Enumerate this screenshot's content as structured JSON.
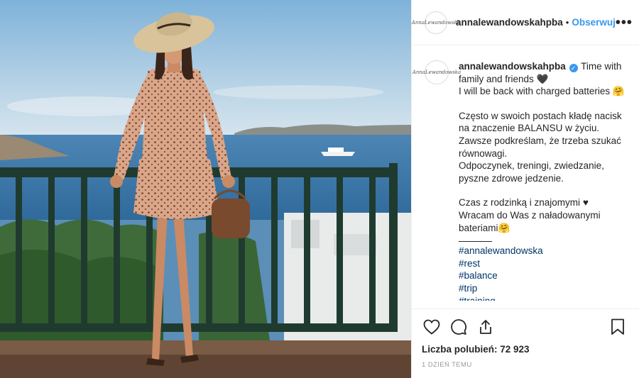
{
  "header": {
    "avatar_signature": "AnnaLewandowska",
    "username": "annalewandowskahpba",
    "separator": "•",
    "follow_label": "Obserwuj",
    "more_icon": "more-horizontal-icon"
  },
  "caption": {
    "username": "annalewandowskahpba",
    "verified_icon": "verified-badge-icon",
    "verified_glyph": "✓",
    "line1": "Time with family and friends",
    "heart1": "🖤",
    "line2": "I will be back with charged batteries",
    "emoji_hug": "🤗",
    "paragraph2": [
      "Często w swoich postach kładę nacisk na znaczenie BALANSU w życiu.",
      "Zawsze podkreślam, że trzeba szukać równowagi.",
      "Odpoczynek, treningi, zwiedzanie, pyszne zdrowe jedzenie."
    ],
    "paragraph3_line1": "Czas z rodzinką i znajomymi",
    "heart2": "♥",
    "paragraph3_line2": "Wracam do Was z naładowanymi bateriami",
    "hashtags": [
      "#annalewandowska",
      "#rest",
      "#balance",
      "#trip",
      "#training"
    ]
  },
  "actions": {
    "like_icon": "heart-icon",
    "comment_icon": "comment-icon",
    "share_icon": "share-icon",
    "save_icon": "bookmark-icon",
    "likes_label": "Liczba polubień:",
    "likes_count": "72 923",
    "timestamp": "1 DZIEŃ TEMU"
  },
  "colors": {
    "link": "#3897f0",
    "hashtag": "#003569",
    "border": "#efefef"
  }
}
